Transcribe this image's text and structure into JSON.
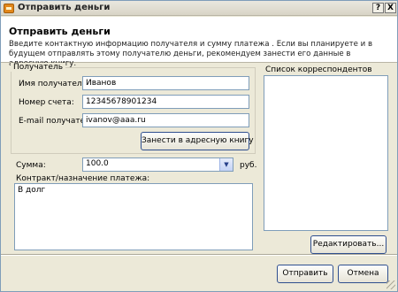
{
  "window": {
    "title": "Отправить деньги",
    "help_label": "?",
    "close_label": "X"
  },
  "header": {
    "title": "Отправить деньги",
    "description": "Введите контактную информацию получателя и сумму платежа . Если вы планируете и в будущем отправлять этому получателю деньги, рекомендуем занести его данные в адресную книгу."
  },
  "recipient": {
    "group_label": "Получатель",
    "name_label": "Имя получателя:",
    "name_value": "Иванов",
    "account_label": "Номер счета:",
    "account_value": "12345678901234",
    "email_label": "E-mail получателя:",
    "email_value": "ivanov@aaa.ru",
    "add_to_book_label": "Занести в адресную книгу"
  },
  "amount": {
    "label": "Сумма:",
    "value": "100.0",
    "currency": "руб."
  },
  "contract": {
    "label": "Контракт/назначение платежа:",
    "value": "В долг"
  },
  "correspondents": {
    "label": "Список корреспондентов",
    "edit_label": "Редактировать..."
  },
  "footer": {
    "send_label": "Отправить",
    "cancel_label": "Отмена"
  },
  "icons": {
    "app": "money-send-icon",
    "dropdown": "chevron-down-icon",
    "resize": "resize-grip-icon"
  }
}
